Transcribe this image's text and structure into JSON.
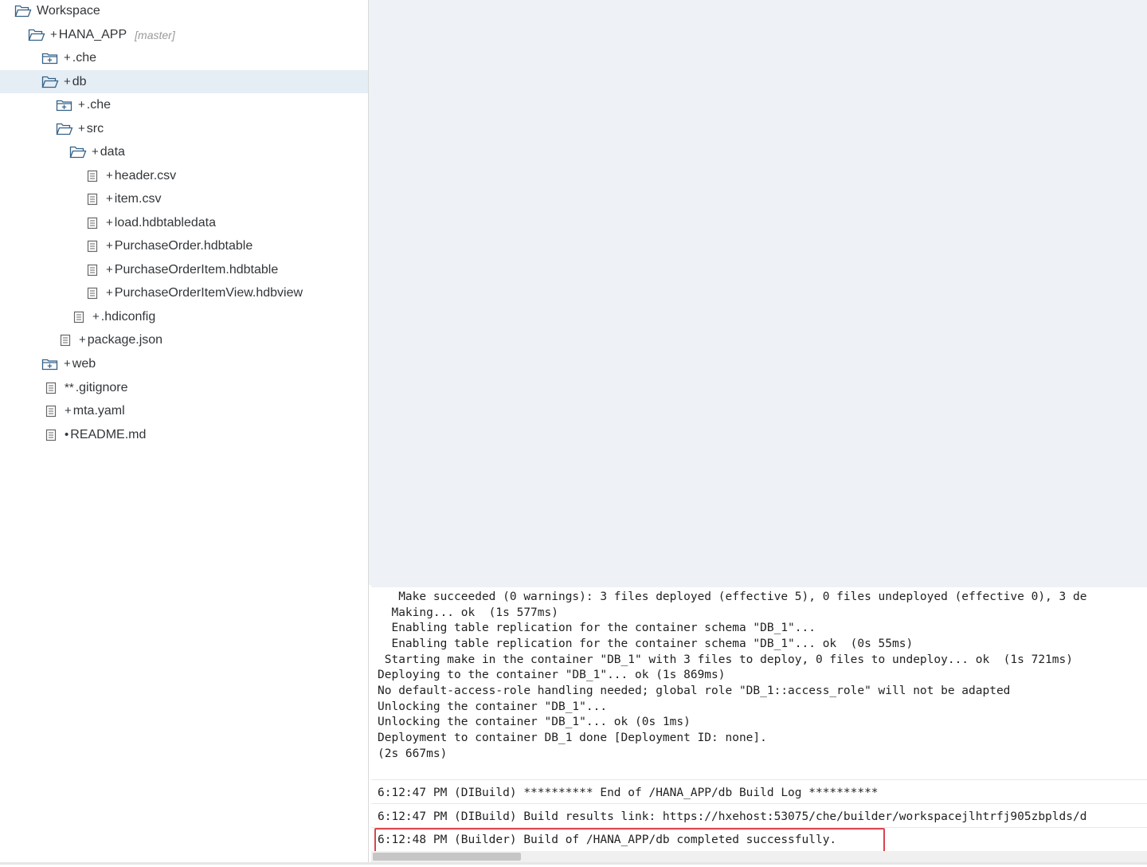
{
  "tree": {
    "items": [
      {
        "label": "Workspace",
        "mark": "",
        "icon": "folder-open-icon",
        "branch": "",
        "selected": false
      },
      {
        "label": "HANA_APP",
        "mark": "+",
        "icon": "folder-open-icon",
        "branch": "[master]",
        "selected": false
      },
      {
        "label": ".che",
        "mark": "+",
        "icon": "folder-closed-icon",
        "branch": "",
        "selected": false
      },
      {
        "label": "db",
        "mark": "+",
        "icon": "folder-open-icon",
        "branch": "",
        "selected": true
      },
      {
        "label": ".che",
        "mark": "+",
        "icon": "folder-closed-icon",
        "branch": "",
        "selected": false
      },
      {
        "label": "src",
        "mark": "+",
        "icon": "folder-open-icon",
        "branch": "",
        "selected": false
      },
      {
        "label": "data",
        "mark": "+",
        "icon": "folder-open-icon",
        "branch": "",
        "selected": false
      },
      {
        "label": "header.csv",
        "mark": "+",
        "icon": "file-icon",
        "branch": "",
        "selected": false
      },
      {
        "label": "item.csv",
        "mark": "+",
        "icon": "file-icon",
        "branch": "",
        "selected": false
      },
      {
        "label": "load.hdbtabledata",
        "mark": "+",
        "icon": "file-icon",
        "branch": "",
        "selected": false
      },
      {
        "label": "PurchaseOrder.hdbtable",
        "mark": "+",
        "icon": "file-icon",
        "branch": "",
        "selected": false
      },
      {
        "label": "PurchaseOrderItem.hdbtable",
        "mark": "+",
        "icon": "file-icon",
        "branch": "",
        "selected": false
      },
      {
        "label": "PurchaseOrderItemView.hdbview",
        "mark": "+",
        "icon": "file-icon",
        "branch": "",
        "selected": false
      },
      {
        "label": ".hdiconfig",
        "mark": "+",
        "icon": "file-icon",
        "branch": "",
        "selected": false
      },
      {
        "label": "package.json",
        "mark": "+",
        "icon": "file-icon",
        "branch": "",
        "selected": false
      },
      {
        "label": "web",
        "mark": "+",
        "icon": "folder-closed-icon",
        "branch": "",
        "selected": false
      },
      {
        "label": ".gitignore",
        "mark": "**",
        "icon": "file-icon",
        "branch": "",
        "selected": false
      },
      {
        "label": "mta.yaml",
        "mark": "+",
        "icon": "file-icon",
        "branch": "",
        "selected": false
      },
      {
        "label": "README.md",
        "mark": "•",
        "icon": "file-icon",
        "branch": "",
        "selected": false
      }
    ]
  },
  "console": {
    "build_log": [
      "   Make succeeded (0 warnings): 3 files deployed (effective 5), 0 files undeployed (effective 0), 3 de",
      "  Making... ok  (1s 577ms)",
      "  Enabling table replication for the container schema \"DB_1\"...",
      "  Enabling table replication for the container schema \"DB_1\"... ok  (0s 55ms)",
      " Starting make in the container \"DB_1\" with 3 files to deploy, 0 files to undeploy... ok  (1s 721ms)",
      "Deploying to the container \"DB_1\"... ok (1s 869ms)",
      "No default-access-role handling needed; global role \"DB_1::access_role\" will not be adapted",
      "Unlocking the container \"DB_1\"...",
      "Unlocking the container \"DB_1\"... ok (0s 1ms)",
      "Deployment to container DB_1 done [Deployment ID: none].",
      "(2s 667ms)"
    ],
    "messages": [
      "6:12:47 PM (DIBuild) ********** End of /HANA_APP/db Build Log **********",
      "6:12:47 PM (DIBuild) Build results link: https://hxehost:53075/che/builder/workspacejlhtrfj905zbplds/d",
      "6:12:48 PM (Builder) Build of /HANA_APP/db completed successfully."
    ]
  },
  "colors": {
    "folder_icon": "#346187",
    "file_icon": "#666666",
    "selection": "#e5edf5",
    "highlight_border": "#d9454d",
    "editor_bg": "#eef1f5"
  }
}
